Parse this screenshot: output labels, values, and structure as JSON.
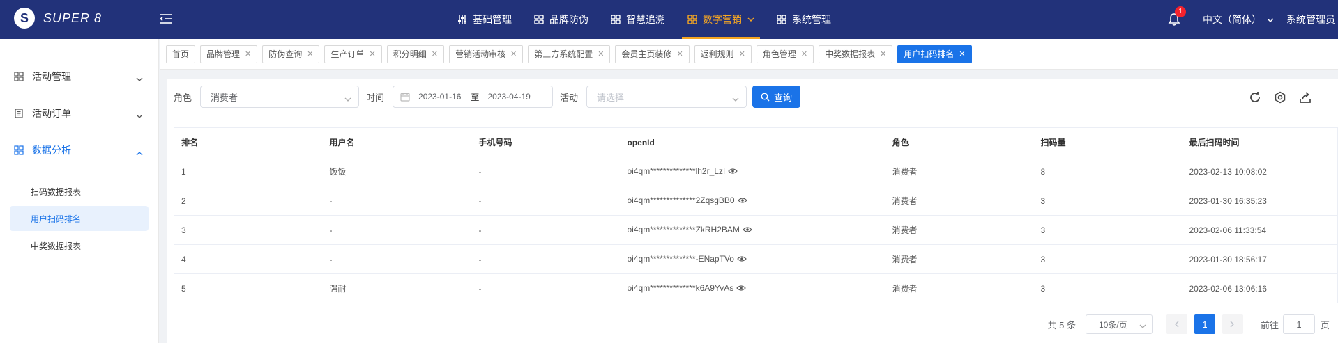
{
  "brand": {
    "logo_letter": "S",
    "name": "SUPER 8"
  },
  "topnav": [
    {
      "label": "基础管理",
      "icon": "sliders-icon"
    },
    {
      "label": "品牌防伪",
      "icon": "grid-icon"
    },
    {
      "label": "智慧追溯",
      "icon": "grid-icon"
    },
    {
      "label": "数字营销",
      "icon": "grid-icon",
      "active": true
    },
    {
      "label": "系统管理",
      "icon": "grid-icon"
    }
  ],
  "header_right": {
    "notification_count": "1",
    "language": "中文（简体）",
    "user": "系统管理员"
  },
  "sidebar": {
    "menus": [
      {
        "label": "活动管理",
        "icon": "grid-icon",
        "open": false
      },
      {
        "label": "活动订单",
        "icon": "document-icon",
        "open": false
      },
      {
        "label": "数据分析",
        "icon": "grid-icon",
        "open": true
      }
    ],
    "submenu": [
      {
        "label": "扫码数据报表",
        "active": false
      },
      {
        "label": "用户扫码排名",
        "active": true
      },
      {
        "label": "中奖数据报表",
        "active": false
      }
    ]
  },
  "tags": [
    {
      "label": "首页",
      "closable": false
    },
    {
      "label": "品牌管理",
      "closable": true
    },
    {
      "label": "防伪查询",
      "closable": true
    },
    {
      "label": "生产订单",
      "closable": true
    },
    {
      "label": "积分明细",
      "closable": true
    },
    {
      "label": "营销活动审核",
      "closable": true
    },
    {
      "label": "第三方系统配置",
      "closable": true
    },
    {
      "label": "会员主页装修",
      "closable": true
    },
    {
      "label": "返利规则",
      "closable": true
    },
    {
      "label": "角色管理",
      "closable": true
    },
    {
      "label": "中奖数据报表",
      "closable": true
    },
    {
      "label": "用户扫码排名",
      "closable": true,
      "active": true
    }
  ],
  "filters": {
    "role_label": "角色",
    "role_value": "消费者",
    "time_label": "时间",
    "date_start": "2023-01-16",
    "date_sep": "至",
    "date_end": "2023-04-19",
    "activity_label": "活动",
    "activity_placeholder": "请选择",
    "query_button": "查询"
  },
  "table": {
    "columns": [
      "排名",
      "用户名",
      "手机号码",
      "openId",
      "角色",
      "扫码量",
      "最后扫码时间"
    ],
    "rows": [
      [
        "1",
        "饭饭",
        "-",
        "oi4qm**************lh2r_LzI",
        "消费者",
        "8",
        "2023-02-13 10:08:02"
      ],
      [
        "2",
        "-",
        "-",
        "oi4qm**************2ZqsgBB0",
        "消费者",
        "3",
        "2023-01-30 16:35:23"
      ],
      [
        "3",
        "-",
        "-",
        "oi4qm**************ZkRH2BAM",
        "消费者",
        "3",
        "2023-02-06 11:33:54"
      ],
      [
        "4",
        "-",
        "-",
        "oi4qm**************-ENapTVo",
        "消费者",
        "3",
        "2023-01-30 18:56:17"
      ],
      [
        "5",
        "强耐",
        "-",
        "oi4qm**************k6A9YvAs",
        "消费者",
        "3",
        "2023-02-06 13:06:16"
      ]
    ]
  },
  "pagination": {
    "total": "共 5 条",
    "page_size": "10条/页",
    "current_page": "1",
    "goto_label": "前往",
    "goto_value": "1",
    "page_unit": "页"
  },
  "colors": {
    "header_bg": "#22327a",
    "accent": "#1a73e8",
    "active_nav": "#f5a623"
  }
}
